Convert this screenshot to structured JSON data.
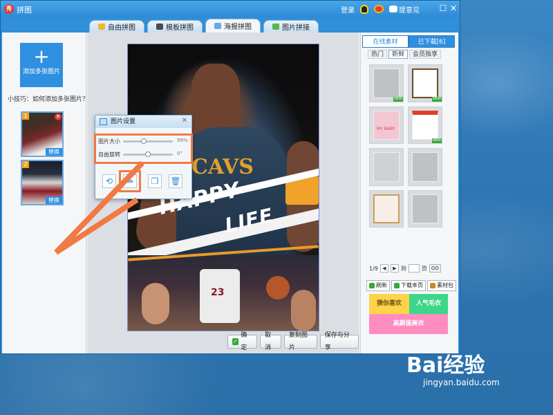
{
  "window": {
    "title": "拼图",
    "login": "登录",
    "feedback": "提意见"
  },
  "tabs": [
    {
      "label": "自由拼图",
      "active": false
    },
    {
      "label": "模板拼图",
      "active": false
    },
    {
      "label": "海报拼图",
      "active": true
    },
    {
      "label": "图片拼接",
      "active": false
    }
  ],
  "left": {
    "add_button": "添加多张图片",
    "tip": "小技巧：如何添加多张图片？",
    "thumbs": [
      {
        "num": "1",
        "replace": "替换"
      },
      {
        "num": "2",
        "replace": "替换"
      }
    ]
  },
  "poster": {
    "line1": "HAPPY",
    "line2": "LIFE",
    "jersey": "CAVS",
    "player_number": "23"
  },
  "dialog": {
    "title": "图片设置",
    "size_label": "图片大小",
    "size_value": "99%",
    "rotate_label": "自由旋转",
    "rotate_value": "0°"
  },
  "bottom_buttons": {
    "confirm": "确定",
    "cancel": "取消",
    "copy": "复制图片",
    "save": "保存与分享"
  },
  "right": {
    "tabs": [
      {
        "label": "在线素材",
        "active": true
      },
      {
        "label": "已下载[6]",
        "active": false
      }
    ],
    "filters": [
      {
        "label": "热门",
        "active": false
      },
      {
        "label": "新鲜",
        "active": true
      },
      {
        "label": "会员独享",
        "active": false
      }
    ],
    "templates": [
      {
        "new": true
      },
      {
        "new": true
      },
      {
        "new": false
      },
      {
        "new": true
      },
      {
        "new": false
      },
      {
        "new": false
      },
      {
        "new": false
      },
      {
        "new": false
      }
    ],
    "template_text": "MY BABY",
    "new_tag": "NEW",
    "pager": {
      "page": "1/9",
      "to": "到",
      "unit": "页",
      "go": "GO"
    },
    "actions": {
      "refresh": "刷新",
      "download_page": "下载本页",
      "material_pack": "素材包"
    },
    "banners": {
      "b1": "猜你喜欢",
      "b2": "人气毛衣",
      "b3": "高颜值美衣"
    }
  },
  "watermark": {
    "brand": "Bai经验",
    "site": "jingyan.baidu.com"
  },
  "colors": {
    "accent": "#2f8fe0",
    "highlight": "#f07a44",
    "window": "#2f8fd8"
  }
}
